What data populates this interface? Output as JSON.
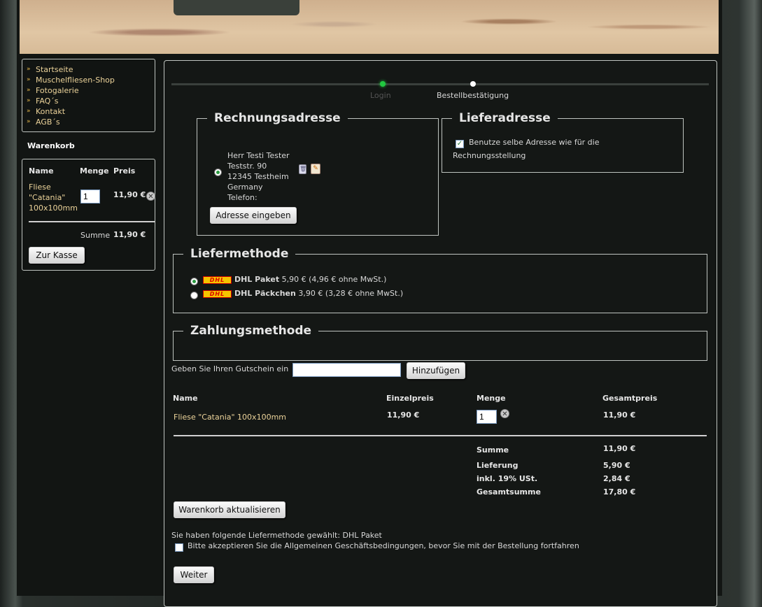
{
  "nav": {
    "items": [
      "Startseite",
      "Muschelfliesen-Shop",
      "Fotogalerie",
      "FAQ´s",
      "Kontakt",
      "AGB´s"
    ]
  },
  "cart": {
    "title": "Warenkorb",
    "headers": {
      "name": "Name",
      "menge": "Menge",
      "preis": "Preis"
    },
    "item": {
      "name_lines": [
        "Fliese",
        "\"Catania\"",
        "100x100mm"
      ],
      "qty": "1",
      "price": "11,90 €"
    },
    "summe_label": "Summe",
    "summe_value": "11,90 €",
    "checkout_label": "Zur Kasse"
  },
  "steps": {
    "login": "Login",
    "confirm": "Bestellbestätigung"
  },
  "billing": {
    "legend": "Rechnungsadresse",
    "address_lines": [
      "Herr Testi Tester",
      "Teststr. 90",
      "12345 Testheim",
      "Germany",
      "Telefon:"
    ],
    "enter_button": "Adresse eingeben"
  },
  "shipping_address": {
    "legend": "Lieferadresse",
    "same_label_line1": "Benutze selbe Adresse wie für die",
    "same_label_line2": "Rechnungsstellung"
  },
  "delivery": {
    "legend": "Liefermethode",
    "logo_text": "DHL",
    "options": [
      {
        "name": "DHL Paket",
        "price": "5,90 € (4,96 € ohne MwSt.)",
        "selected": true
      },
      {
        "name": "DHL Päckchen",
        "price": "3,90 € (3,28 € ohne MwSt.)",
        "selected": false
      }
    ]
  },
  "payment": {
    "legend": "Zahlungsmethode"
  },
  "voucher": {
    "label": "Geben Sie Ihren Gutschein ein",
    "value": "",
    "button": "Hinzufügen"
  },
  "order": {
    "headers": {
      "name": "Name",
      "einzelpreis": "Einzelpreis",
      "menge": "Menge",
      "gesamtpreis": "Gesamtpreis"
    },
    "item": {
      "name": "Fliese \"Catania\" 100x100mm",
      "einzelpreis": "11,90 €",
      "qty": "1",
      "gesamtpreis": "11,90 €"
    },
    "totals": [
      {
        "label": "Summe",
        "value": "11,90 €"
      },
      {
        "label": "Lieferung",
        "value": "5,90 €"
      },
      {
        "label": "inkl. 19% USt.",
        "value": "2,84 €"
      },
      {
        "label": "Gesamtsumme",
        "value": "17,80 €"
      }
    ],
    "update_button": "Warenkorb aktualisieren"
  },
  "chosen_method_text": "Sie haben folgende Liefermethode gewählt: DHL Paket",
  "agb_text": "Bitte akzeptieren Sie die Allgemeinen Geschäftsbedingungen, bevor Sie mit der Bestellung fortfahren",
  "next_button": "Weiter",
  "colors": {
    "accent_gold": "#ecd39a",
    "step_active": "#22c840",
    "background": "#121513"
  }
}
